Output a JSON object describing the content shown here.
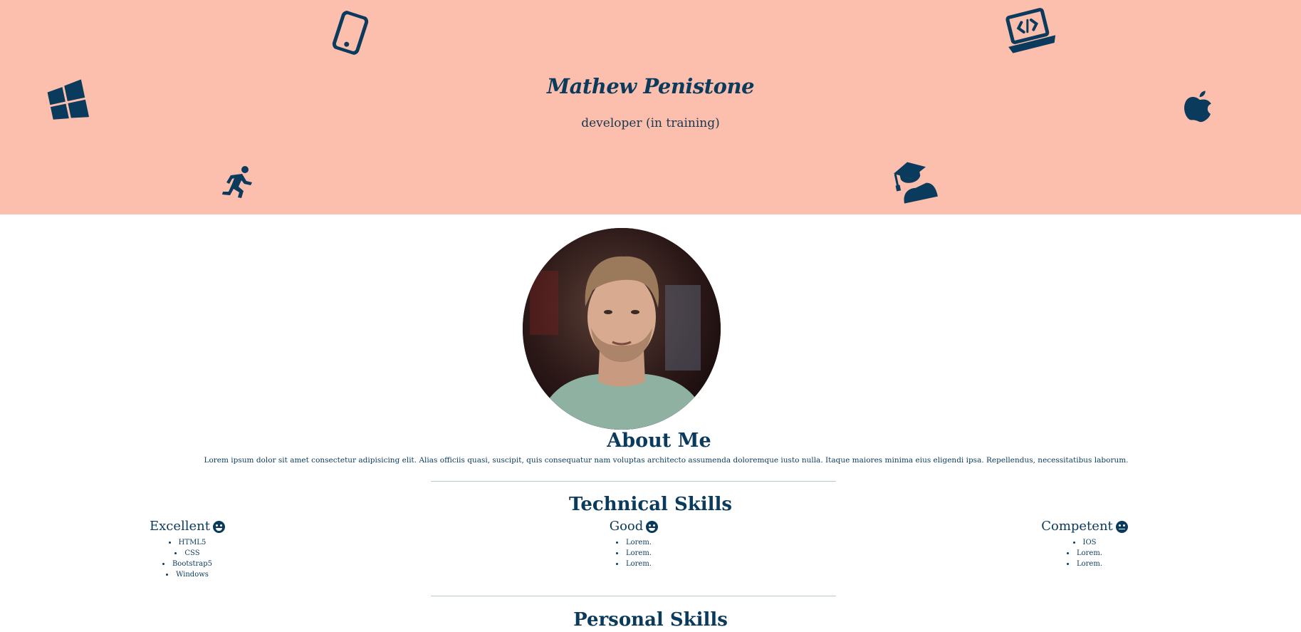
{
  "header": {
    "name": "Mathew Penistone",
    "tagline": "developer (in training)",
    "icons": [
      "windows-icon",
      "mobile-phone-icon",
      "running-person-icon",
      "laptop-code-icon",
      "apple-icon",
      "graduate-icon"
    ],
    "background": "#fcbfad",
    "ink": "#0a3a5c"
  },
  "about": {
    "heading": "About Me",
    "text": "Lorem ipsum dolor sit amet consectetur adipisicing elit. Alias officiis quasi, suscipit, quis consequatur nam voluptas architecto assumenda doloremque iusto nulla. Itaque maiores minima eius eligendi ipsa. Repellendus, necessitatibus laborum."
  },
  "technical": {
    "heading": "Technical Skills",
    "columns": [
      {
        "title": "Excellent",
        "items": [
          "HTML5",
          "CSS",
          "Bootstrap5",
          "Windows"
        ]
      },
      {
        "title": "Good",
        "items": [
          "Lorem.",
          "Lorem.",
          "Lorem."
        ]
      },
      {
        "title": "Competent",
        "items": [
          "IOS",
          "Lorem.",
          "Lorem."
        ]
      }
    ]
  },
  "personal": {
    "heading": "Personal Skills"
  }
}
